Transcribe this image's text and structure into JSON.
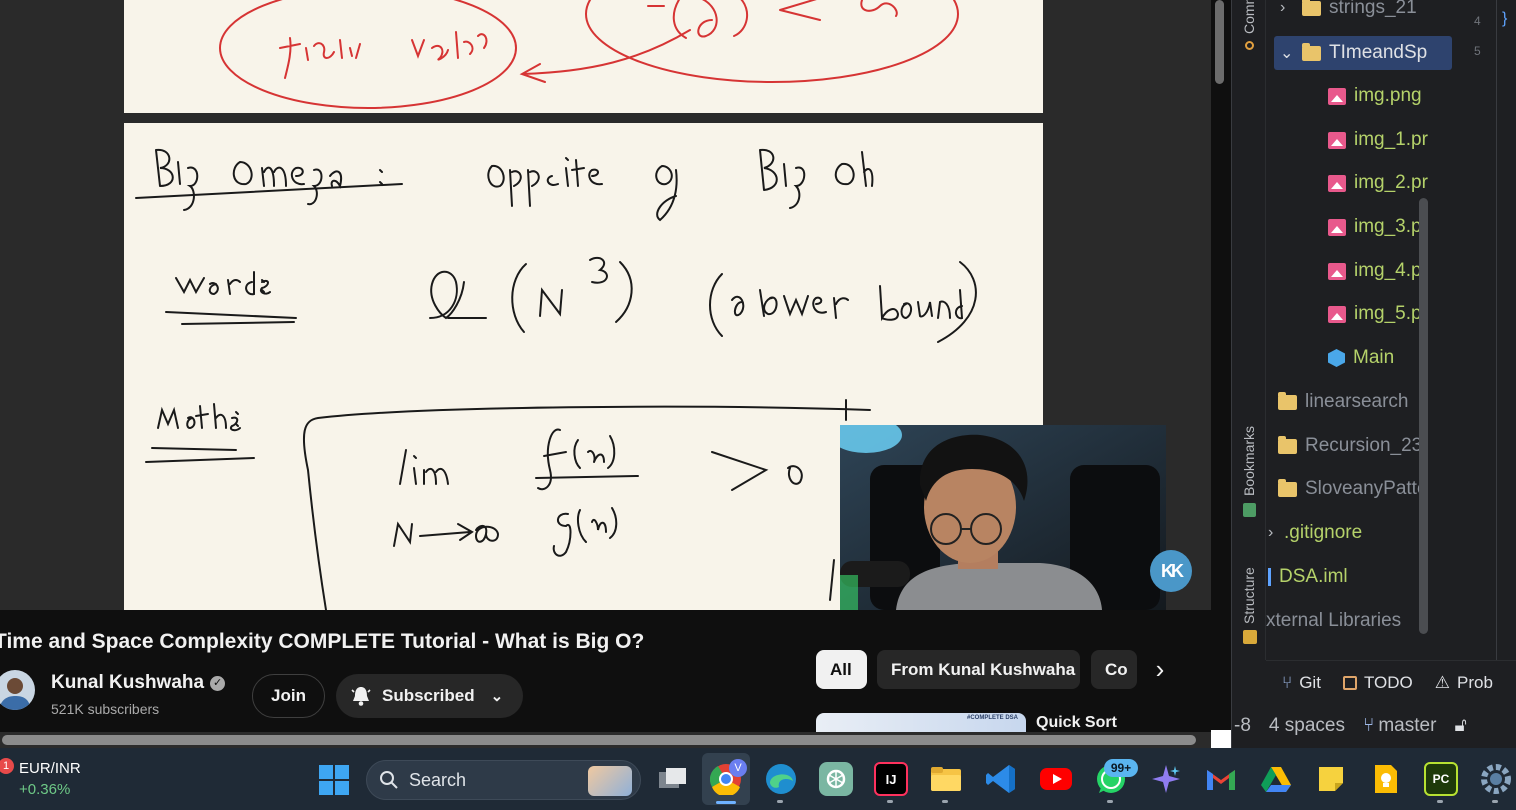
{
  "video": {
    "webcam_logo": "KK"
  },
  "youtube": {
    "title": "Time and Space Complexity COMPLETE Tutorial - What is Big O?",
    "channel_name": "Kunal Kushwaha",
    "verified_icon": "verified-check-icon",
    "subscribers": "521K subscribers",
    "join_label": "Join",
    "subscribed_label": "Subscribed",
    "chips": [
      "All",
      "From Kunal Kushwaha",
      "Co"
    ],
    "next_video_title": "Quick Sort",
    "next_video_thumb_text": "#COMPLETE DSA"
  },
  "ide": {
    "side_tabs": [
      "Commit",
      "Bookmarks",
      "Structure"
    ],
    "tree": [
      {
        "label": "strings_21",
        "kind": "folder",
        "expanded": false
      },
      {
        "label": "TImeandSp",
        "kind": "folder",
        "expanded": true,
        "selected": true
      },
      {
        "label": "img.png",
        "kind": "image"
      },
      {
        "label": "img_1.pr",
        "kind": "image"
      },
      {
        "label": "img_2.pr",
        "kind": "image"
      },
      {
        "label": "img_3.pr",
        "kind": "image"
      },
      {
        "label": "img_4.pr",
        "kind": "image"
      },
      {
        "label": "img_5.pr",
        "kind": "image"
      },
      {
        "label": "Main",
        "kind": "java-class"
      },
      {
        "label": "linearsearch",
        "kind": "folder"
      },
      {
        "label": "Recursion_23",
        "kind": "folder"
      },
      {
        "label": "SloveanyPatte",
        "kind": "folder"
      },
      {
        "label": ".gitignore",
        "kind": "file"
      },
      {
        "label": "DSA.iml",
        "kind": "file"
      },
      {
        "label": "xternal Libraries",
        "kind": "library"
      }
    ],
    "line_numbers": [
      "4",
      "5"
    ],
    "editor_brace": "}",
    "tool_tabs": {
      "git": "Git",
      "todo": "TODO",
      "problems": "Prob"
    },
    "status": {
      "encoding": "-8",
      "indent": "4 spaces",
      "branch": "master"
    }
  },
  "taskbar": {
    "ticker_badge": "1",
    "ticker_symbol": "EUR/INR",
    "ticker_change": "+0.36%",
    "search_label": "Search",
    "chrome_badge": "V",
    "whatsapp_badge": "99+",
    "jetbrains_label": "IJ",
    "pycharm_label": "PC"
  },
  "colors": {
    "paper": "#f8f4ea",
    "ink_black": "#1a1a1a",
    "ink_red": "#d63434",
    "youtube_bg": "#0f0f0f",
    "ide_bg": "#1e1f22",
    "ide_file_text": "#b5d26a",
    "ide_dim_text": "#8a8f98",
    "taskbar_bg": "#1f2a36"
  }
}
